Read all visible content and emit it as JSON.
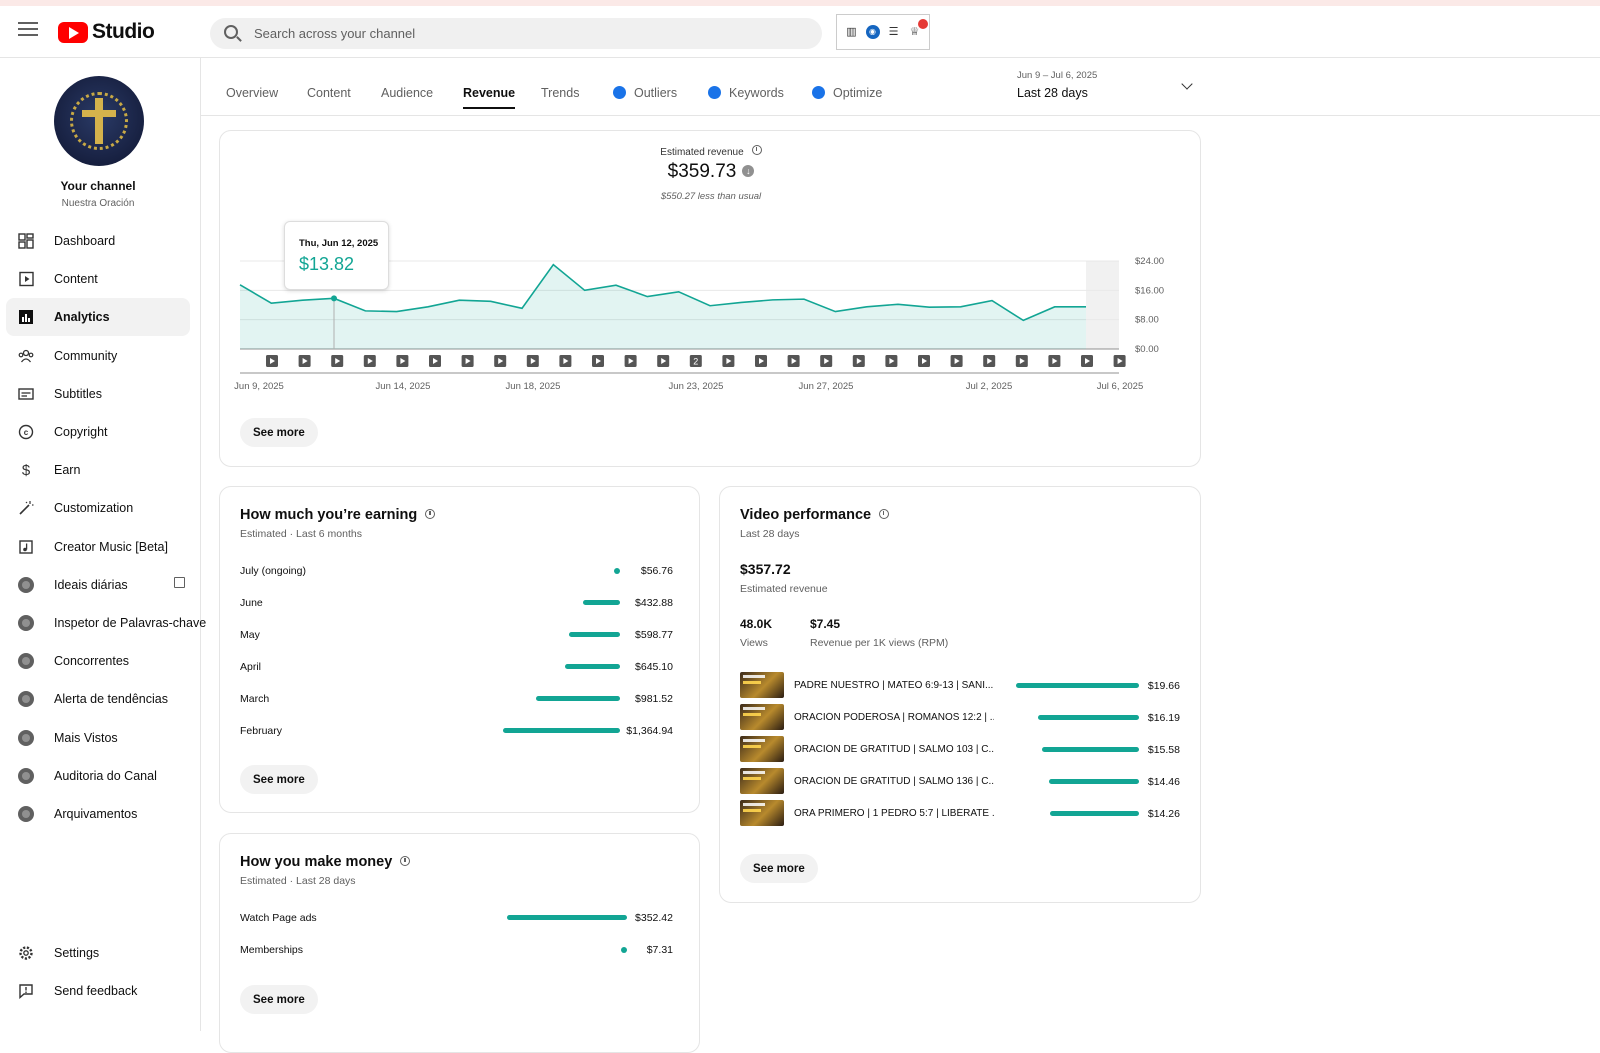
{
  "header": {
    "app_name": "Studio",
    "search_placeholder": "Search across your channel"
  },
  "sidebar": {
    "channel_title": "Your channel",
    "channel_name": "Nuestra Oración",
    "items": [
      {
        "label": "Dashboard",
        "icon": "dashboard-icon"
      },
      {
        "label": "Content",
        "icon": "content-icon"
      },
      {
        "label": "Analytics",
        "icon": "analytics-icon",
        "active": true
      },
      {
        "label": "Community",
        "icon": "community-icon"
      },
      {
        "label": "Subtitles",
        "icon": "subtitles-icon"
      },
      {
        "label": "Copyright",
        "icon": "copyright-icon"
      },
      {
        "label": "Earn",
        "icon": "dollar-icon"
      },
      {
        "label": "Customization",
        "icon": "magic-wand-icon"
      },
      {
        "label": "Creator Music [Beta]",
        "icon": "music-icon"
      },
      {
        "label": "Ideais diárias",
        "icon": "extension-icon"
      },
      {
        "label": "Inspetor de Palavras-chave",
        "icon": "extension-icon"
      },
      {
        "label": "Concorrentes",
        "icon": "extension-icon"
      },
      {
        "label": "Alerta de tendências",
        "icon": "extension-icon"
      },
      {
        "label": "Mais Vistos",
        "icon": "extension-icon"
      },
      {
        "label": "Auditoria do Canal",
        "icon": "extension-icon"
      },
      {
        "label": "Arquivamentos",
        "icon": "extension-icon"
      }
    ],
    "settings_label": "Settings",
    "feedback_label": "Send feedback"
  },
  "tabs": {
    "items": [
      "Overview",
      "Content",
      "Audience",
      "Revenue",
      "Trends",
      "Outliers",
      "Keywords",
      "Optimize"
    ],
    "active": "Revenue",
    "date_range": "Jun 9 – Jul 6, 2025",
    "period": "Last 28 days"
  },
  "revenue_chart": {
    "label": "Estimated revenue",
    "value": "$359.73",
    "note": "$550.27 less than usual",
    "tooltip_date": "Thu, Jun 12, 2025",
    "tooltip_value": "$13.82",
    "see_more": "See more"
  },
  "chart_data": {
    "type": "area",
    "title": "Estimated revenue",
    "x": [
      "2025-06-09",
      "2025-06-10",
      "2025-06-11",
      "2025-06-12",
      "2025-06-13",
      "2025-06-14",
      "2025-06-15",
      "2025-06-16",
      "2025-06-17",
      "2025-06-18",
      "2025-06-19",
      "2025-06-20",
      "2025-06-21",
      "2025-06-22",
      "2025-06-23",
      "2025-06-24",
      "2025-06-25",
      "2025-06-26",
      "2025-06-27",
      "2025-06-28",
      "2025-06-29",
      "2025-06-30",
      "2025-07-01",
      "2025-07-02",
      "2025-07-03",
      "2025-07-04",
      "2025-07-05",
      "2025-07-06"
    ],
    "values": [
      17.5,
      12.5,
      13.3,
      13.82,
      10.4,
      10.2,
      11.5,
      13.3,
      13.0,
      11.1,
      23.0,
      16.0,
      17.4,
      14.3,
      15.6,
      11.8,
      12.7,
      13.4,
      13.6,
      10.2,
      11.5,
      12.2,
      11.4,
      11.5,
      13.2,
      7.8,
      11.5,
      11.5
    ],
    "yticks": [
      "$24.00",
      "$16.00",
      "$8.00",
      "$0.00"
    ],
    "ylim": [
      0,
      24
    ],
    "xticks": [
      "Jun 9, 2025",
      "Jun 14, 2025",
      "Jun 18, 2025",
      "Jun 23, 2025",
      "Jun 27, 2025",
      "Jul 2, 2025",
      "Jul 6, 2025"
    ],
    "marker_label": "2",
    "grid": true
  },
  "earning": {
    "title": "How much you’re earning",
    "subtitle": "Estimated · Last 6 months",
    "rows": [
      {
        "label": "July (ongoing)",
        "value": "$56.76",
        "amount": 56.76
      },
      {
        "label": "June",
        "value": "$432.88",
        "amount": 432.88
      },
      {
        "label": "May",
        "value": "$598.77",
        "amount": 598.77
      },
      {
        "label": "April",
        "value": "$645.10",
        "amount": 645.1
      },
      {
        "label": "March",
        "value": "$981.52",
        "amount": 981.52
      },
      {
        "label": "February",
        "value": "$1,364.94",
        "amount": 1364.94
      }
    ],
    "see_more": "See more"
  },
  "money": {
    "title": "How you make money",
    "subtitle": "Estimated · Last 28 days",
    "rows": [
      {
        "label": "Watch Page ads",
        "value": "$352.42",
        "amount": 352.42
      },
      {
        "label": "Memberships",
        "value": "$7.31",
        "amount": 7.31
      }
    ],
    "see_more": "See more"
  },
  "video_performance": {
    "title": "Video performance",
    "subtitle": "Last 28 days",
    "revenue": "$357.72",
    "revenue_label": "Estimated revenue",
    "views": "48.0K",
    "views_label": "Views",
    "rpm": "$7.45",
    "rpm_label": "Revenue per 1K views (RPM)",
    "videos": [
      {
        "title": "PADRE NUESTRO | MATEO 6:9-13 | SANI...",
        "value": "$19.66",
        "amount": 19.66
      },
      {
        "title": "ORACIÓN PODEROSA | ROMANOS 12:2 | ...",
        "value": "$16.19",
        "amount": 16.19
      },
      {
        "title": "ORACIÓN DE GRATITUD | SALMO 103 | C...",
        "value": "$15.58",
        "amount": 15.58
      },
      {
        "title": "ORACIÓN DE GRATITUD | SALMO 136 | C...",
        "value": "$14.46",
        "amount": 14.46
      },
      {
        "title": "ORA PRIMERO | 1 PEDRO 5:7 | LIBÉRATE ...",
        "value": "$14.26",
        "amount": 14.26
      }
    ],
    "see_more": "See more"
  },
  "colors": {
    "accent": "#12a594",
    "brand_red": "#ff0000"
  }
}
